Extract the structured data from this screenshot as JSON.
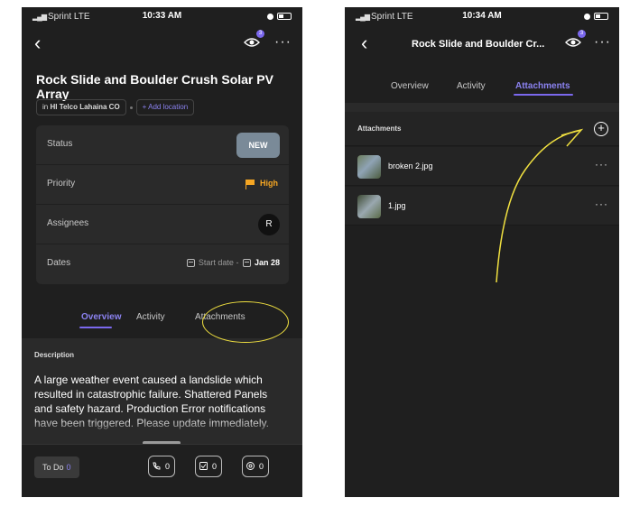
{
  "left_phone": {
    "status_bar": {
      "carrier": "Sprint  LTE",
      "time": "10:33 AM"
    },
    "nav": {
      "back_icon": "chevron-left",
      "watchers_badge": "3",
      "more_icon": "ellipsis"
    },
    "task_title": "Rock Slide and Boulder Crush Solar PV Array",
    "location_prefix": "in",
    "location": "HI Telco Lahaina CO",
    "add_location_label": "+ Add location",
    "fields": {
      "status_label": "Status",
      "status_value": "NEW",
      "priority_label": "Priority",
      "priority_value": "High",
      "assignees_label": "Assignees",
      "assignee_initial": "R",
      "dates_label": "Dates",
      "start_date": "Start date",
      "date_sep": "-",
      "due_date": "Jan 28"
    },
    "tabs": [
      "Overview",
      "Activity",
      "Attachments"
    ],
    "active_tab": "Overview",
    "description_label": "Description",
    "description_text": "A large weather event caused a landslide which resulted in catastrophic failure. Shattered Panels and safety hazard. Production Error notifications have been triggered. Please update immediately.",
    "bottom": {
      "todo_label": "To Do",
      "todo_count": "0",
      "calls_count": "0",
      "checklist_count": "0",
      "watchers_count": "0"
    },
    "colors": {
      "accent": "#7b68ee",
      "priority": "#f5a623",
      "status_pill": "#7a8a98",
      "annotation": "#f0e040"
    }
  },
  "right_phone": {
    "status_bar": {
      "carrier": "Sprint  LTE",
      "time": "10:34 AM"
    },
    "nav": {
      "title": "Rock Slide and Boulder Cr...",
      "watchers_badge": "3"
    },
    "tabs": [
      "Overview",
      "Activity",
      "Attachments"
    ],
    "active_tab": "Attachments",
    "attachments_label": "Attachments",
    "attachments": [
      {
        "name": "broken 2.jpg"
      },
      {
        "name": "1.jpg"
      }
    ]
  }
}
